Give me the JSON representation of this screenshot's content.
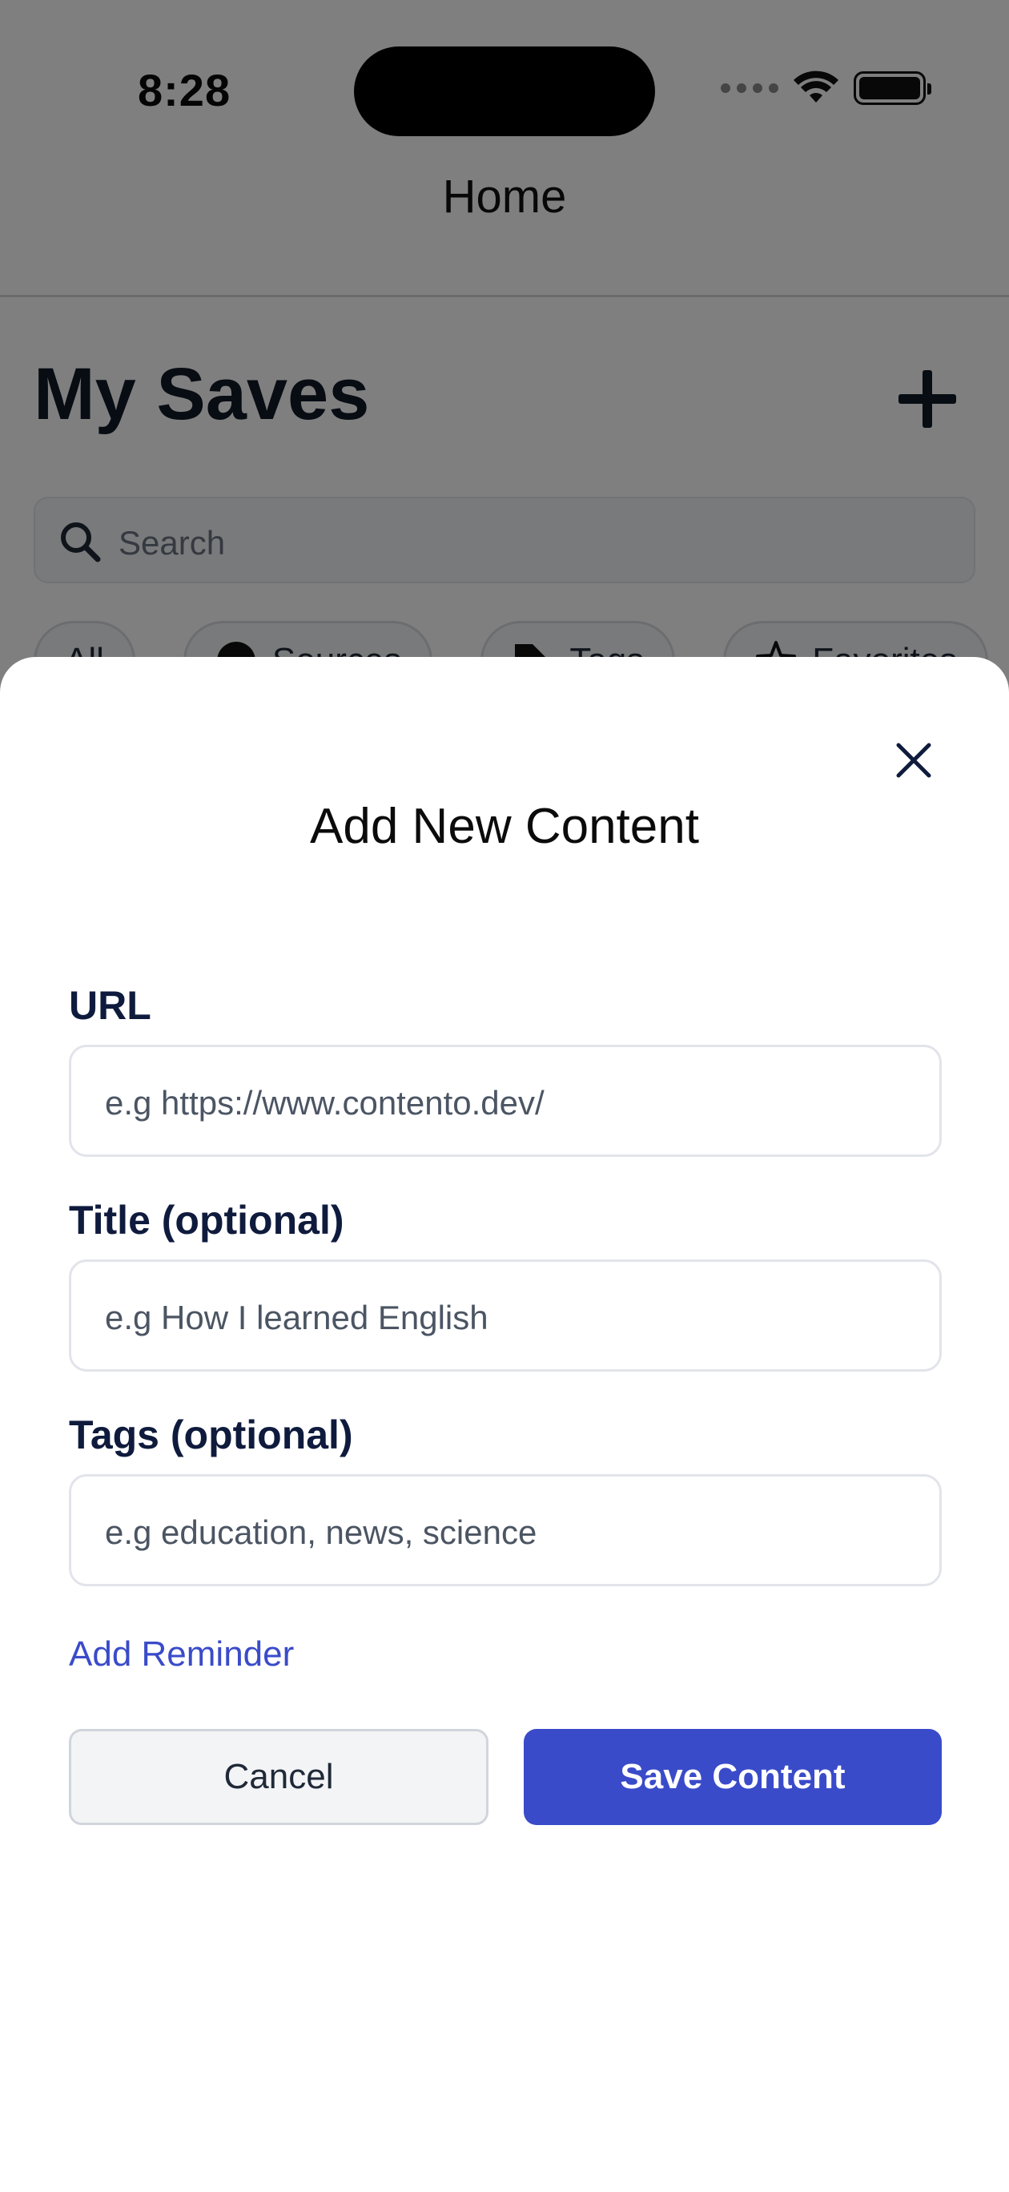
{
  "status_bar": {
    "time": "8:28"
  },
  "nav": {
    "title": "Home"
  },
  "home": {
    "title": "My Saves",
    "search_placeholder": "Search",
    "chips": [
      "All",
      "Sources",
      "Tags",
      "Favorites"
    ]
  },
  "modal": {
    "title": "Add New Content",
    "url_label": "URL",
    "url_placeholder": "e.g https://www.contento.dev/",
    "title_label": "Title (optional)",
    "title_placeholder": "e.g How I learned English",
    "tags_label": "Tags (optional)",
    "tags_placeholder": "e.g education, news, science",
    "reminder_link": "Add Reminder",
    "cancel_label": "Cancel",
    "save_label": "Save Content"
  },
  "colors": {
    "accent": "#3a4bc9",
    "label": "#0f1b3d",
    "overlay": "rgba(0,0,0,0.5)"
  },
  "icons": [
    "wifi-icon",
    "battery-icon",
    "plus-icon",
    "search-icon",
    "globe-icon",
    "tag-icon",
    "star-icon",
    "close-icon"
  ]
}
